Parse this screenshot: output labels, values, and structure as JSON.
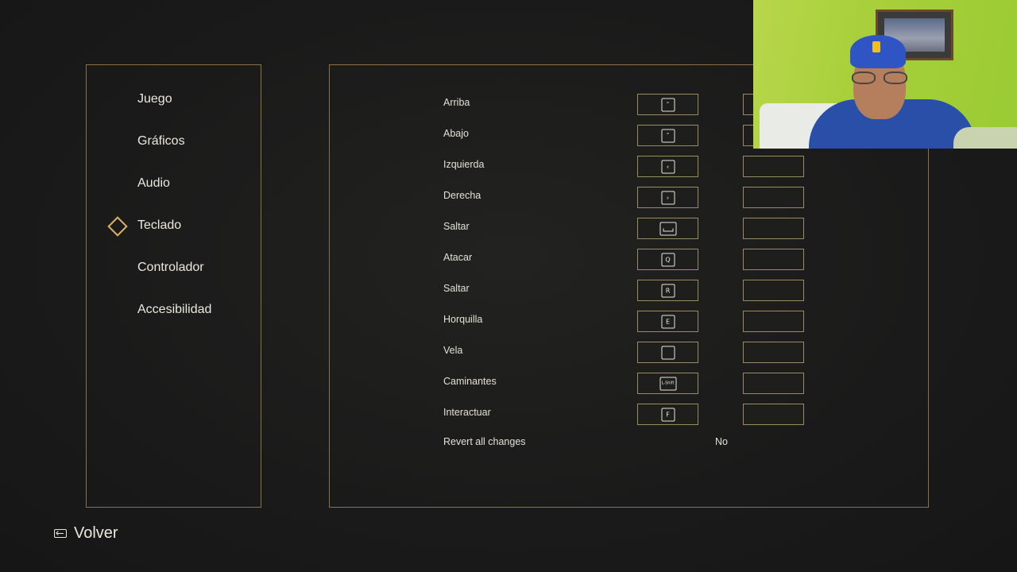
{
  "sidebar": {
    "items": [
      {
        "label": "Juego",
        "selected": false
      },
      {
        "label": "Gráficos",
        "selected": false
      },
      {
        "label": "Audio",
        "selected": false
      },
      {
        "label": "Teclado",
        "selected": true
      },
      {
        "label": "Controlador",
        "selected": false
      },
      {
        "label": "Accesibilidad",
        "selected": false
      }
    ]
  },
  "bindings": [
    {
      "action": "Arriba",
      "primary_key": "˄",
      "primary_icon": "arrow-up-key-icon"
    },
    {
      "action": "Abajo",
      "primary_key": "˅",
      "primary_icon": "arrow-down-key-icon"
    },
    {
      "action": "Izquierda",
      "primary_key": "‹",
      "primary_icon": "arrow-left-key-icon"
    },
    {
      "action": "Derecha",
      "primary_key": "›",
      "primary_icon": "arrow-right-key-icon"
    },
    {
      "action": "Saltar",
      "primary_key": "",
      "primary_icon": "spacebar-key-icon"
    },
    {
      "action": "Atacar",
      "primary_key": "Q",
      "primary_icon": "q-key-icon"
    },
    {
      "action": "Saltar",
      "primary_key": "R",
      "primary_icon": "r-key-icon"
    },
    {
      "action": "Horquilla",
      "primary_key": "E",
      "primary_icon": "e-key-icon"
    },
    {
      "action": "Vela",
      "primary_key": "",
      "primary_icon": "blank-key-icon"
    },
    {
      "action": "Caminantes",
      "primary_key": "L-Shift",
      "primary_icon": "left-shift-key-icon"
    },
    {
      "action": "Interactuar",
      "primary_key": "F",
      "primary_icon": "f-key-icon"
    }
  ],
  "revert": {
    "label": "Revert all changes",
    "value": "No"
  },
  "back": {
    "label": "Volver",
    "icon": "back-key-icon"
  },
  "colors": {
    "accent_gold": "#8a7246",
    "selection_gold": "#d8b26a",
    "background": "#1b1b1b"
  }
}
